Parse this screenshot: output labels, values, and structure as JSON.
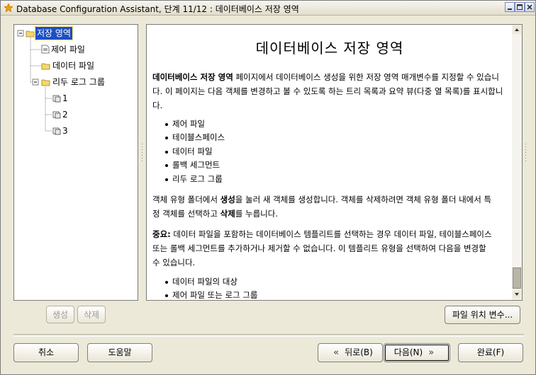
{
  "window": {
    "title": "Database Configuration Assistant, 단계 11/12 : 데이터베이스 저장 영역"
  },
  "tree": {
    "root": "저장 영역",
    "items": [
      {
        "label": "제어 파일",
        "icon": "document-icon"
      },
      {
        "label": "데이터 파일",
        "icon": "folder-icon"
      },
      {
        "label": "리두 로그 그룹",
        "icon": "folder-icon"
      }
    ],
    "redo_groups": [
      "1",
      "2",
      "3"
    ]
  },
  "content": {
    "title": "데이터베이스 저장 영역",
    "intro_bold": "데이터베이스 저장 영역",
    "intro_rest": " 페이지에서 데이터베이스 생성을 위한 저장 영역 매개변수를 지정할 수 있습니다. 이 페이지는 다음 객체를 변경하고 볼 수 있도록 하는 트리 목록과 요약 뷰(다중 열 목록)를 표시합니다.",
    "objects": [
      "제어 파일",
      "테이블스페이스",
      "데이터 파일",
      "롤백 세그먼트",
      "리두 로그 그룹"
    ],
    "create_para_1": "객체 유형 폴더에서 ",
    "create_bold": "생성",
    "create_para_2": "을 눌러 새 객체를 생성합니다. 객체를 삭제하려면 객체 유형 폴더 내에서 특정 객체를 선택하고 ",
    "delete_bold": "삭제",
    "create_para_3": "를 누릅니다.",
    "note_bold": "중요:",
    "note_rest": " 데이터 파일을 포함하는 데이터베이스 템플리트를 선택하는 경우 데이터 파일, 테이블스페이스 또는 롤백 세그먼트를 추가하거나 제거할 수 없습니다. 이 템플리트 유형을 선택하여 다음을 변경할 수 있습니다.",
    "changes": [
      "데이터 파일의 대상",
      "제어 파일 또는 로그 그룹"
    ]
  },
  "buttons": {
    "create": "생성",
    "delete": "삭제",
    "file_location_vars": "파일 위치 변수...",
    "cancel": "취소",
    "help": "도움말",
    "back": "뒤로(B)",
    "next": "다음(N)",
    "finish": "완료(F)"
  }
}
